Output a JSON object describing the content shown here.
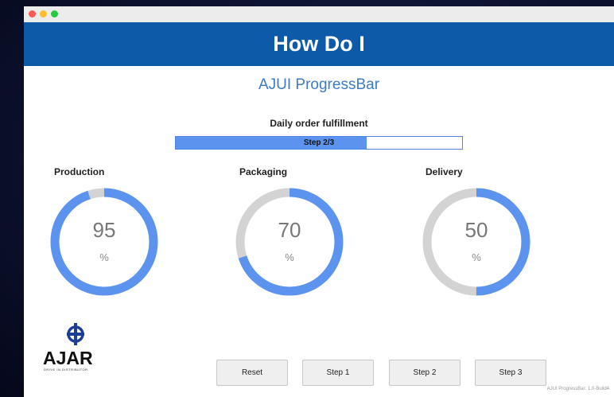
{
  "window": {
    "banner_title": "How Do I",
    "subtitle": "AJUI ProgressBar"
  },
  "progress": {
    "title": "Daily order fulfillment",
    "text": "Step 2/3",
    "fraction": 0.667,
    "color": "#5b93ee"
  },
  "gauges": [
    {
      "label": "Production",
      "value": "95",
      "unit": "%",
      "percent": 95,
      "color": "#5b93ee",
      "track": "#d3d3d3"
    },
    {
      "label": "Packaging",
      "value": "70",
      "unit": "%",
      "percent": 70,
      "color": "#5b93ee",
      "track": "#d3d3d3"
    },
    {
      "label": "Delivery",
      "value": "50",
      "unit": "%",
      "percent": 50,
      "color": "#5b93ee",
      "track": "#d3d3d3"
    }
  ],
  "logo": {
    "text": "AJAR",
    "tagline": "DRIVE IN DISTRIBUTOR",
    "icon": "ajar-logo-icon"
  },
  "buttons": {
    "reset": "Reset",
    "step1": "Step 1",
    "step2": "Step 2",
    "step3": "Step 3"
  },
  "footer": {
    "version": "AJUI ProgressBar: 1.0-Build4"
  },
  "colors": {
    "banner": "#0d5aa9",
    "accent": "#3d7bc7"
  }
}
